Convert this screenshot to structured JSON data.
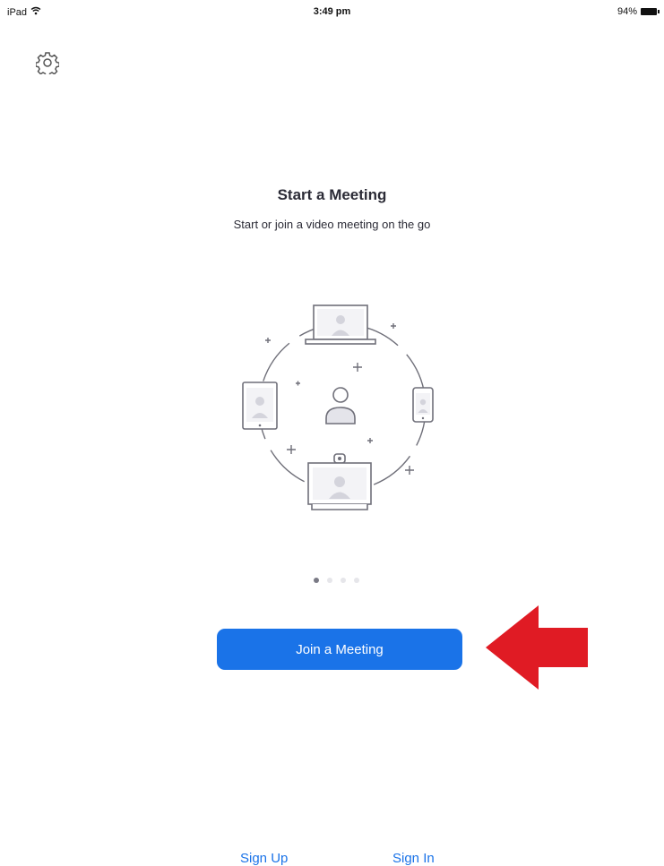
{
  "status_bar": {
    "device": "iPad",
    "wifi_icon": "wifi-icon",
    "time": "3:49 pm",
    "battery_percent": "94%",
    "battery_icon": "battery-icon"
  },
  "settings": {
    "icon": "gear-icon"
  },
  "onboarding": {
    "title": "Start a Meeting",
    "subtitle": "Start or join a video meeting on the go",
    "page_index": 1,
    "page_count": 4
  },
  "actions": {
    "join_label": "Join a Meeting",
    "sign_up_label": "Sign Up",
    "sign_in_label": "Sign In"
  },
  "colors": {
    "accent": "#1a73e8",
    "arrow": "#e01b24",
    "illustration_stroke": "#6f6f79"
  }
}
